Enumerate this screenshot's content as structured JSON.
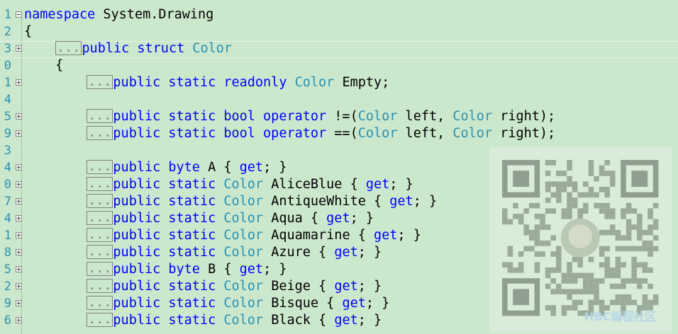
{
  "editor": {
    "lines": [
      {
        "num": "1",
        "fold": "minus",
        "indent": 0,
        "collapsed": false,
        "tokens": [
          [
            "kw",
            "namespace"
          ],
          [
            "pl",
            " System.Drawing"
          ]
        ]
      },
      {
        "num": "2",
        "fold": "",
        "indent": 0,
        "collapsed": false,
        "tokens": [
          [
            "pl",
            "{"
          ]
        ]
      },
      {
        "num": "3",
        "fold": "plus",
        "indent": 1,
        "collapsed": true,
        "tokens": [
          [
            "kw",
            "public struct "
          ],
          [
            "ty",
            "Color"
          ]
        ]
      },
      {
        "num": "0",
        "fold": "",
        "indent": 1,
        "collapsed": false,
        "tokens": [
          [
            "pl",
            "{"
          ]
        ]
      },
      {
        "num": "1",
        "fold": "plus",
        "indent": 2,
        "collapsed": true,
        "tokens": [
          [
            "kw",
            "public static readonly "
          ],
          [
            "ty",
            "Color"
          ],
          [
            "pl",
            " Empty;"
          ]
        ]
      },
      {
        "num": "4",
        "fold": "",
        "indent": 0,
        "collapsed": false,
        "tokens": []
      },
      {
        "num": "5",
        "fold": "plus",
        "indent": 2,
        "collapsed": true,
        "tokens": [
          [
            "kw",
            "public static bool operator "
          ],
          [
            "pl",
            "!=("
          ],
          [
            "ty",
            "Color"
          ],
          [
            "pl",
            " left, "
          ],
          [
            "ty",
            "Color"
          ],
          [
            "pl",
            " right);"
          ]
        ]
      },
      {
        "num": "9",
        "fold": "plus",
        "indent": 2,
        "collapsed": true,
        "tokens": [
          [
            "kw",
            "public static bool operator "
          ],
          [
            "pl",
            "==("
          ],
          [
            "ty",
            "Color"
          ],
          [
            "pl",
            " left, "
          ],
          [
            "ty",
            "Color"
          ],
          [
            "pl",
            " right);"
          ]
        ]
      },
      {
        "num": "3",
        "fold": "",
        "indent": 0,
        "collapsed": false,
        "tokens": []
      },
      {
        "num": "4",
        "fold": "plus",
        "indent": 2,
        "collapsed": true,
        "tokens": [
          [
            "kw",
            "public byte "
          ],
          [
            "pl",
            "A { "
          ],
          [
            "kw",
            "get"
          ],
          [
            "pl",
            "; }"
          ]
        ]
      },
      {
        "num": "0",
        "fold": "plus",
        "indent": 2,
        "collapsed": true,
        "tokens": [
          [
            "kw",
            "public static "
          ],
          [
            "ty",
            "Color"
          ],
          [
            "pl",
            " AliceBlue { "
          ],
          [
            "kw",
            "get"
          ],
          [
            "pl",
            "; }"
          ]
        ]
      },
      {
        "num": "7",
        "fold": "plus",
        "indent": 2,
        "collapsed": true,
        "tokens": [
          [
            "kw",
            "public static "
          ],
          [
            "ty",
            "Color"
          ],
          [
            "pl",
            " AntiqueWhite { "
          ],
          [
            "kw",
            "get"
          ],
          [
            "pl",
            "; }"
          ]
        ]
      },
      {
        "num": "4",
        "fold": "plus",
        "indent": 2,
        "collapsed": true,
        "tokens": [
          [
            "kw",
            "public static "
          ],
          [
            "ty",
            "Color"
          ],
          [
            "pl",
            " Aqua { "
          ],
          [
            "kw",
            "get"
          ],
          [
            "pl",
            "; }"
          ]
        ]
      },
      {
        "num": "1",
        "fold": "plus",
        "indent": 2,
        "collapsed": true,
        "tokens": [
          [
            "kw",
            "public static "
          ],
          [
            "ty",
            "Color"
          ],
          [
            "pl",
            " Aquamarine { "
          ],
          [
            "kw",
            "get"
          ],
          [
            "pl",
            "; }"
          ]
        ]
      },
      {
        "num": "8",
        "fold": "plus",
        "indent": 2,
        "collapsed": true,
        "tokens": [
          [
            "kw",
            "public static "
          ],
          [
            "ty",
            "Color"
          ],
          [
            "pl",
            " Azure { "
          ],
          [
            "kw",
            "get"
          ],
          [
            "pl",
            "; }"
          ]
        ]
      },
      {
        "num": "5",
        "fold": "plus",
        "indent": 2,
        "collapsed": true,
        "tokens": [
          [
            "kw",
            "public byte "
          ],
          [
            "pl",
            "B { "
          ],
          [
            "kw",
            "get"
          ],
          [
            "pl",
            "; }"
          ]
        ]
      },
      {
        "num": "2",
        "fold": "plus",
        "indent": 2,
        "collapsed": true,
        "tokens": [
          [
            "kw",
            "public static "
          ],
          [
            "ty",
            "Color"
          ],
          [
            "pl",
            " Beige { "
          ],
          [
            "kw",
            "get"
          ],
          [
            "pl",
            "; }"
          ]
        ]
      },
      {
        "num": "9",
        "fold": "plus",
        "indent": 2,
        "collapsed": true,
        "tokens": [
          [
            "kw",
            "public static "
          ],
          [
            "ty",
            "Color"
          ],
          [
            "pl",
            " Bisque { "
          ],
          [
            "kw",
            "get"
          ],
          [
            "pl",
            "; }"
          ]
        ]
      },
      {
        "num": "6",
        "fold": "plus",
        "indent": 2,
        "collapsed": true,
        "tokens": [
          [
            "kw",
            "public static "
          ],
          [
            "ty",
            "Color"
          ],
          [
            "pl",
            " Black { "
          ],
          [
            "kw",
            "get"
          ],
          [
            "pl",
            "; }"
          ]
        ]
      }
    ],
    "collapsed_marker": "...",
    "colors": {
      "background": "#cce8cc",
      "keyword": "#0000ff",
      "type": "#2b91af",
      "line_number": "#2b91af"
    }
  },
  "overlay": {
    "qr_icon": "qr-code",
    "watermark_text": "HBC编程社区"
  }
}
